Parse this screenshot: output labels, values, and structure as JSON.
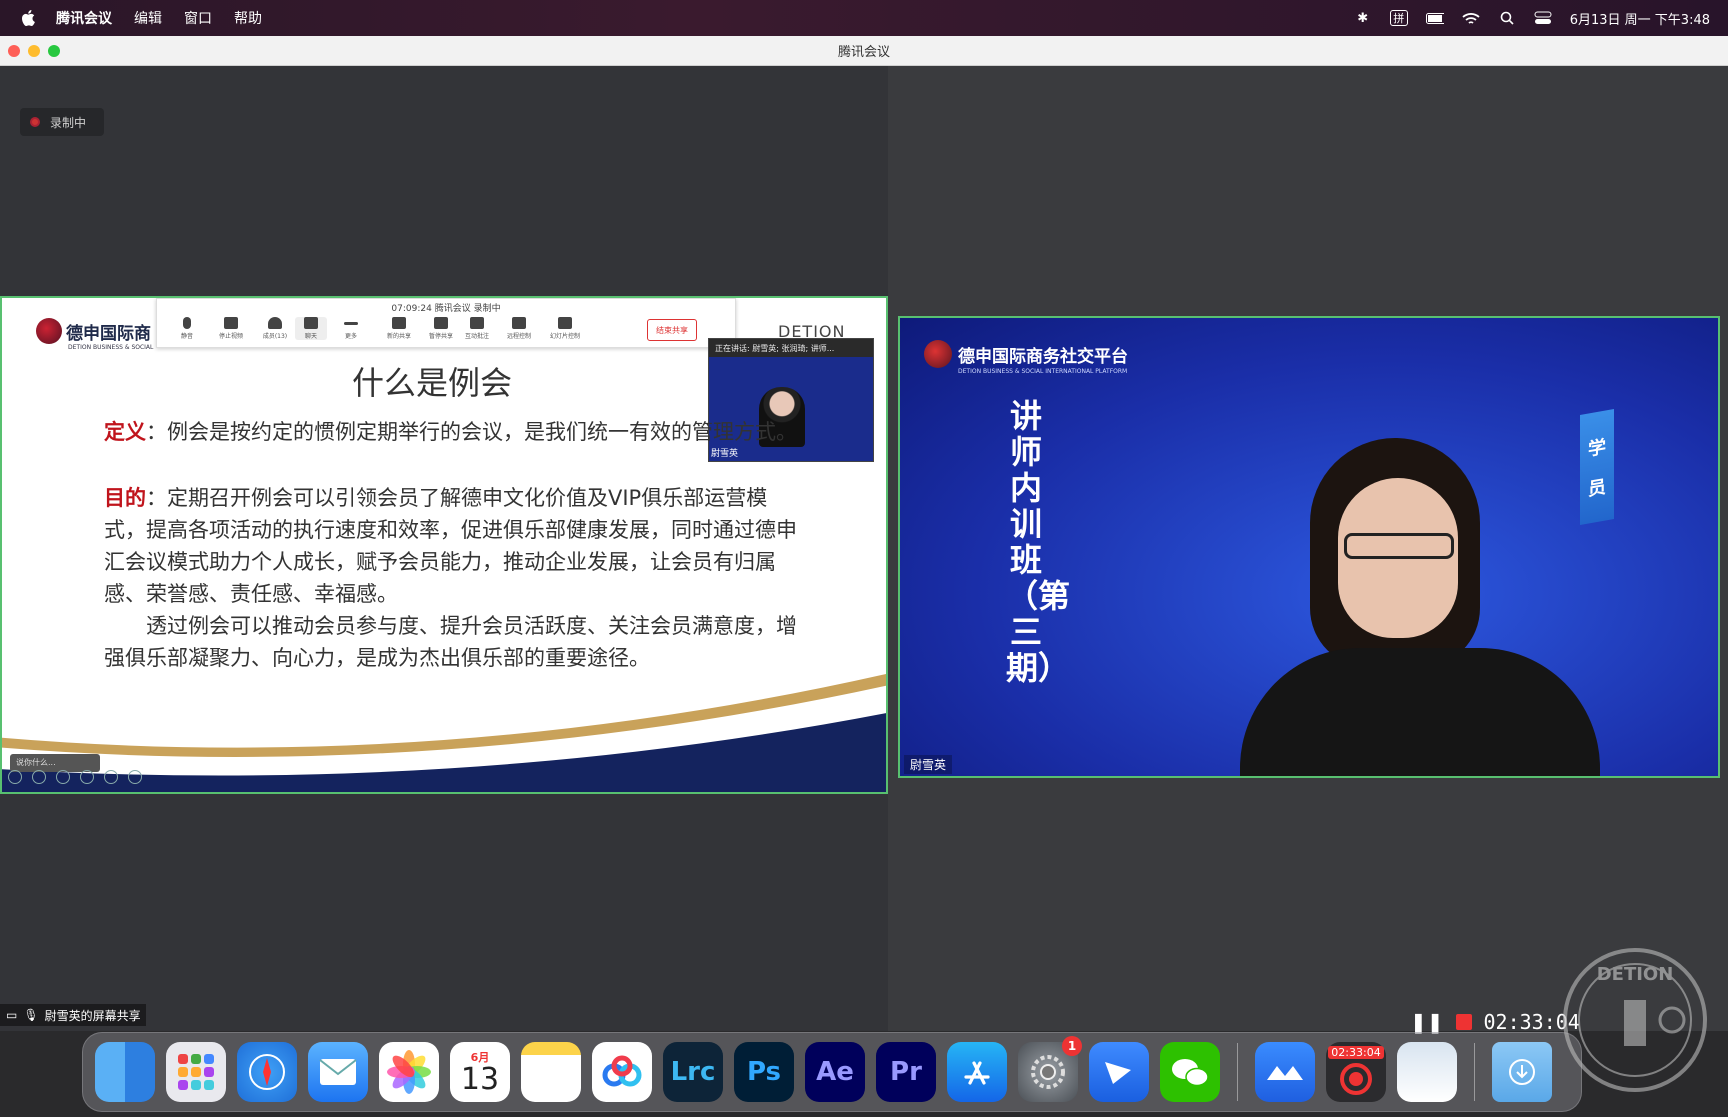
{
  "menubar": {
    "app": "腾讯会议",
    "items": [
      "编辑",
      "窗口",
      "帮助"
    ],
    "datetime": "6月13日 周一 下午3:48",
    "input_method": "拼"
  },
  "window": {
    "title": "腾讯会议"
  },
  "recording_badge": "录制中",
  "shared_slide": {
    "logo_text": "德申国际商",
    "logo_sub": "DETION BUSINESS & SOCIAL",
    "detion": "DETION",
    "toolbar": {
      "top_line": "07:09:24 腾讯会议 录制中",
      "buttons": [
        "静音",
        "停止视频",
        "成员(13)",
        "聊天",
        "更多",
        "新的共享",
        "暂停共享",
        "互动批注",
        "远程控制",
        "幻灯片控制"
      ],
      "end_button": "结束共享"
    },
    "title": "什么是例会",
    "definition_label": "定义",
    "definition_text": "：例会是按约定的惯例定期举行的会议，是我们统一有效的管理方式。",
    "purpose_label": "目的",
    "purpose_text": "：定期召开例会可以引领会员了解德申文化价值及VIP俱乐部运营模式，提高各项活动的执行速度和效率，促进俱乐部健康发展，同时通过德申汇会议模式助力个人成长，赋予会员能力，推动企业发展，让会员有归属感、荣誉感、责任感、幸福感。",
    "conclusion": "透过例会可以推动会员参与度、提升会员活跃度、关注会员满意度，增强俱乐部凝聚力、向心力，是成为杰出俱乐部的重要途径。",
    "pip_bar": "正在讲话: 尉雪英; 张润琦; 讲师...",
    "pip_name": "尉雪英",
    "speaking_tag": "说你什么..."
  },
  "video": {
    "brand": "德申国际商务社交平台",
    "brand_sub": "DETION BUSINESS & SOCIAL INTERNATIONAL PLATFORM",
    "vertical_title": "讲师内训班（第三期）",
    "side_banner": [
      "学",
      "员"
    ],
    "name": "尉雪英"
  },
  "share_label": "尉雪英的屏幕共享",
  "dock": {
    "calendar_month": "6月",
    "calendar_day": "13",
    "apps": [
      "Finder",
      "Launchpad",
      "Safari",
      "Mail",
      "Photos",
      "Calendar",
      "Notes",
      "Baidu Netdisk",
      "Lrc",
      "Ps",
      "Ae",
      "Pr",
      "App Store",
      "System Preferences",
      "Feishu",
      "WeChat",
      "Tencent Meeting",
      "Recorder",
      "Preview",
      "Downloads"
    ],
    "settings_badge": "1",
    "recorder_time": "02:33:04"
  },
  "recording": {
    "timer": "02:33:04"
  },
  "seal_text": "DETION",
  "colors": {
    "accent_green": "#58c070",
    "slide_red": "#c0141c",
    "video_blue": "#1a2ea8"
  }
}
